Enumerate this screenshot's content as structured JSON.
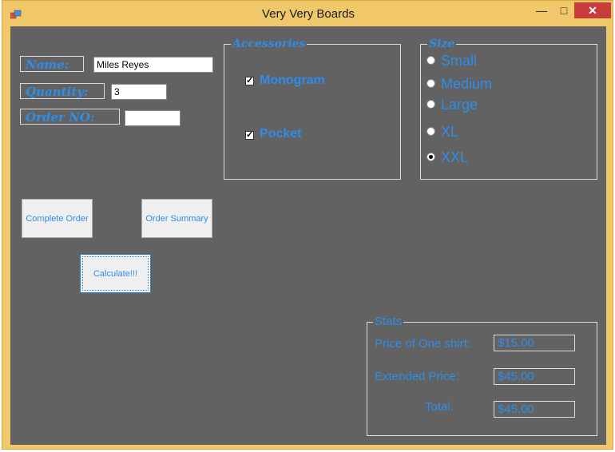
{
  "window": {
    "title": "Very Very Boards",
    "minimize_glyph": "—",
    "maximize_glyph": "□",
    "close_glyph": "✕",
    "app_icon": "app-form-icon"
  },
  "order": {
    "name_label": "Name:",
    "name_value": "Miles Reyes",
    "quantity_label": "Quantity:",
    "quantity_value": "3",
    "order_no_label": "Order NO:",
    "order_no_value": ""
  },
  "accessories": {
    "title": "Accessories",
    "items": [
      {
        "label": "Monogram",
        "checked": true
      },
      {
        "label": "Pocket",
        "checked": true
      }
    ]
  },
  "size": {
    "title": "Size",
    "options": [
      {
        "label": "Small",
        "selected": false
      },
      {
        "label": "Medium",
        "selected": false
      },
      {
        "label": "Large",
        "selected": false
      },
      {
        "label": "XL",
        "selected": false
      },
      {
        "label": "XXL",
        "selected": true
      }
    ]
  },
  "buttons": {
    "complete_order": "Complete Order",
    "order_summary": "Order Summary",
    "calculate": "Calculate!!!"
  },
  "stats": {
    "title": "Stats",
    "price_label": "Price of One shirt:",
    "price_value": "$15.00",
    "extended_label": "Extended Price:",
    "extended_value": "$45.00",
    "total_label": "Total:",
    "total_value": "$45.00"
  },
  "colors": {
    "accent": "#2f8de8",
    "background": "#626262",
    "frame": "#f0c86a",
    "close": "#c83c3c"
  }
}
